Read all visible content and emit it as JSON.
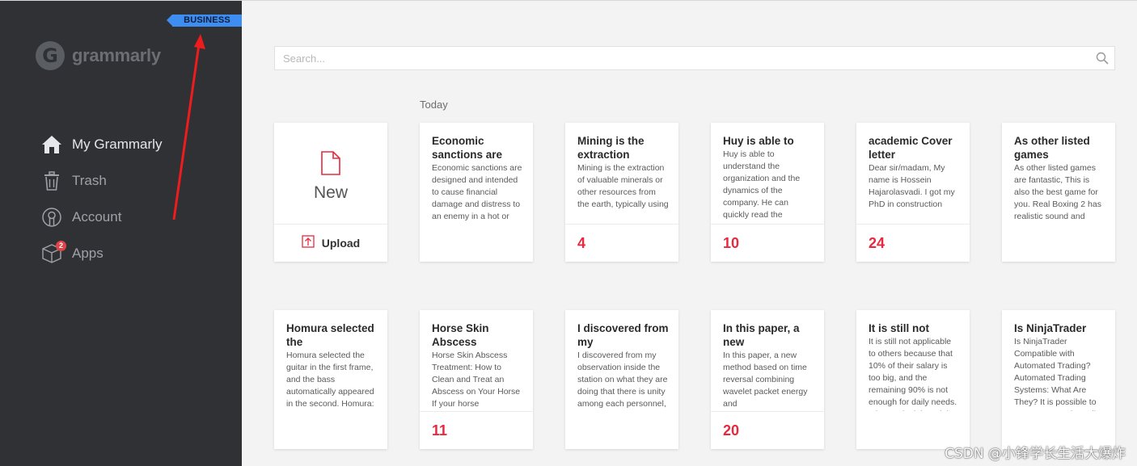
{
  "sidebar": {
    "badge": "BUSINESS",
    "logo_text": "grammarly",
    "nav": [
      {
        "label": "My Grammarly",
        "icon": "home-icon",
        "active": true
      },
      {
        "label": "Trash",
        "icon": "trash-icon",
        "active": false
      },
      {
        "label": "Account",
        "icon": "account-icon",
        "active": false
      },
      {
        "label": "Apps",
        "icon": "apps-box-icon",
        "active": false,
        "count": "2"
      }
    ]
  },
  "search": {
    "placeholder": "Search..."
  },
  "section_label": "Today",
  "new_card": {
    "new_label": "New",
    "upload_label": "Upload"
  },
  "documents": [
    {
      "title": "Economic sanctions are",
      "body": "Economic sanctions are designed and intended to cause financial damage and distress to an enemy in a hot or cold war. Economic sanctions",
      "count": ""
    },
    {
      "title": "Mining is the extraction",
      "body": "Mining is the extraction of valuable minerals or other resources from the earth, typically using",
      "count": "4"
    },
    {
      "title": "Huy is able to",
      "body": "Huy is able to understand the organization and the dynamics of the company. He can quickly read the",
      "count": "10"
    },
    {
      "title": "academic Cover letter",
      "body": "Dear sir/madam, My name is Hossein Hajarolasvadi. I got my PhD in construction",
      "count": "24"
    },
    {
      "title": "As other listed games",
      "body": "As other listed games are fantastic, This is also the best game for you. Real Boxing 2 has realistic sound and graphics. Simple control will help you",
      "count": ""
    },
    {
      "title": "Homura selected the",
      "body": "Homura selected the guitar in the first frame, and the bass automatically appeared in the second. Homura: \"...\" The skills I can merge",
      "count": ""
    },
    {
      "title": "Horse Skin Abscess",
      "body": "Horse Skin Abscess Treatment: How to Clean and Treat an Abscess on Your Horse If your horse",
      "count": "11"
    },
    {
      "title": "I discovered from my",
      "body": "I discovered from my observation inside the station on what they are doing that there is unity among each personnel, and you can see how they",
      "count": ""
    },
    {
      "title": "In this paper, a new",
      "body": "In this paper, a new method based on time reversal combining wavelet packet energy and",
      "count": "20"
    },
    {
      "title": "It is still not",
      "body": "It is still not applicable to others because that 10% of their salary is too big, and the remaining 90% is not enough for daily needs. It is mostly debated that",
      "count": ""
    },
    {
      "title": "Is NinjaTrader",
      "body": "Is NinjaTrader Compatible with Automated Trading? Automated Trading Systems: What Are They? It is possible to create automatic trading systems, also",
      "count": ""
    }
  ],
  "watermark": "CSDN @小锋学长生活大爆炸",
  "colors": {
    "sidebar": "#2f3135",
    "badge": "#3d8ef0",
    "accent_red": "#e8283e",
    "background": "#f3f3f3"
  }
}
